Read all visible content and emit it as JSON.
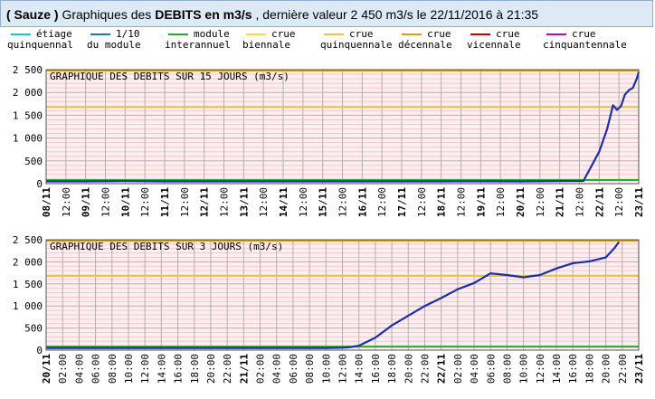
{
  "header": {
    "station": "( Sauze )",
    "prefix": "Graphiques des",
    "bold_label": "DEBITS en m3/s",
    "suffix": ", dernière valeur 2 450 m3/s le 22/11/2016 à 21:35"
  },
  "legend": [
    {
      "line1": "étiage",
      "line2": "quinquennal",
      "color": "#19c8c8"
    },
    {
      "line1": "1/10",
      "line2": "du module",
      "color": "#1a7fa8"
    },
    {
      "line1": "module",
      "line2": "interannuel",
      "color": "#22b022"
    },
    {
      "line1": "crue",
      "line2": "biennale",
      "color": "#e8e040"
    },
    {
      "line1": "crue",
      "line2": "quinquennale",
      "color": "#e8c840"
    },
    {
      "line1": "crue",
      "line2": "décennale",
      "color": "#e0a000"
    },
    {
      "line1": "crue",
      "line2": "vicennale",
      "color": "#c00000"
    },
    {
      "line1": "crue",
      "line2": "cinquantennale",
      "color": "#c000c0"
    }
  ],
  "chart_data": [
    {
      "type": "line",
      "title": "GRAPHIQUE DES DEBITS SUR 15 JOURS (m3/s)",
      "ylim": [
        0,
        2500
      ],
      "yticks": [
        0,
        500,
        1000,
        1500,
        2000,
        2500
      ],
      "ytick_labels": [
        "0",
        "500",
        "1 000",
        "1 500",
        "2 000",
        "2 500"
      ],
      "x_range": [
        "08/11 00:00",
        "23/11 00:00"
      ],
      "xtick_labels": [
        "08/11",
        "12:00",
        "09/11",
        "12:00",
        "10/11",
        "12:00",
        "11/11",
        "12:00",
        "12/11",
        "12:00",
        "13/11",
        "12:00",
        "14/11",
        "12:00",
        "15/11",
        "12:00",
        "16/11",
        "12:00",
        "17/11",
        "12:00",
        "18/11",
        "12:00",
        "19/11",
        "12:00",
        "20/11",
        "12:00",
        "21/11",
        "12:00",
        "22/11",
        "12:00",
        "23/11"
      ],
      "grid": true,
      "reference_lines": [
        {
          "name": "module interannuel",
          "value": 80,
          "color": "#22b022"
        },
        {
          "name": "crue quinquennale",
          "value": 1680,
          "color": "#e8c840"
        },
        {
          "name": "crue décennale",
          "value": 2480,
          "color": "#e0a000"
        }
      ],
      "series": [
        {
          "color": "#1a2fa8",
          "x": [
            0,
            1,
            2,
            3,
            4,
            5,
            6,
            7,
            8,
            9,
            10,
            11,
            12,
            13,
            13.6,
            14.0,
            14.2,
            14.35,
            14.45,
            14.55,
            14.65,
            14.75,
            14.85,
            14.95,
            15.0
          ],
          "y": [
            50,
            50,
            55,
            50,
            50,
            50,
            50,
            50,
            50,
            50,
            50,
            52,
            50,
            55,
            60,
            700,
            1200,
            1720,
            1620,
            1700,
            1950,
            2050,
            2100,
            2300,
            2450
          ]
        }
      ]
    },
    {
      "type": "line",
      "title": "GRAPHIQUE DES DEBITS SUR 3 JOURS (m3/s)",
      "ylim": [
        0,
        2500
      ],
      "yticks": [
        0,
        500,
        1000,
        1500,
        2000,
        2500
      ],
      "ytick_labels": [
        "0",
        "500",
        "1 000",
        "1 500",
        "2 000",
        "2 500"
      ],
      "x_range": [
        "20/11 00:00",
        "23/11 00:00"
      ],
      "xtick_labels": [
        "20/11",
        "02:00",
        "04:00",
        "06:00",
        "08:00",
        "10:00",
        "12:00",
        "14:00",
        "16:00",
        "18:00",
        "20:00",
        "22:00",
        "21/11",
        "02:00",
        "04:00",
        "06:00",
        "08:00",
        "10:00",
        "12:00",
        "14:00",
        "16:00",
        "18:00",
        "20:00",
        "22:00",
        "22/11",
        "02:00",
        "04:00",
        "06:00",
        "08:00",
        "10:00",
        "12:00",
        "14:00",
        "16:00",
        "18:00",
        "20:00",
        "22:00",
        "23/11"
      ],
      "grid": true,
      "reference_lines": [
        {
          "name": "module interannuel",
          "value": 80,
          "color": "#22b022"
        },
        {
          "name": "crue quinquennale",
          "value": 1680,
          "color": "#e8c840"
        },
        {
          "name": "crue décennale",
          "value": 2480,
          "color": "#e0a000"
        }
      ],
      "series": [
        {
          "color": "#1a2fa8",
          "x": [
            0,
            12,
            24,
            30,
            34,
            36,
            37,
            38,
            40,
            42,
            44,
            46,
            48,
            50,
            52,
            54,
            56,
            58,
            60,
            62,
            64,
            66,
            68,
            69,
            69.6
          ],
          "y": [
            50,
            50,
            50,
            50,
            50,
            55,
            70,
            100,
            280,
            560,
            780,
            1000,
            1180,
            1380,
            1520,
            1740,
            1700,
            1650,
            1700,
            1850,
            1970,
            2010,
            2100,
            2300,
            2450
          ]
        }
      ]
    }
  ]
}
